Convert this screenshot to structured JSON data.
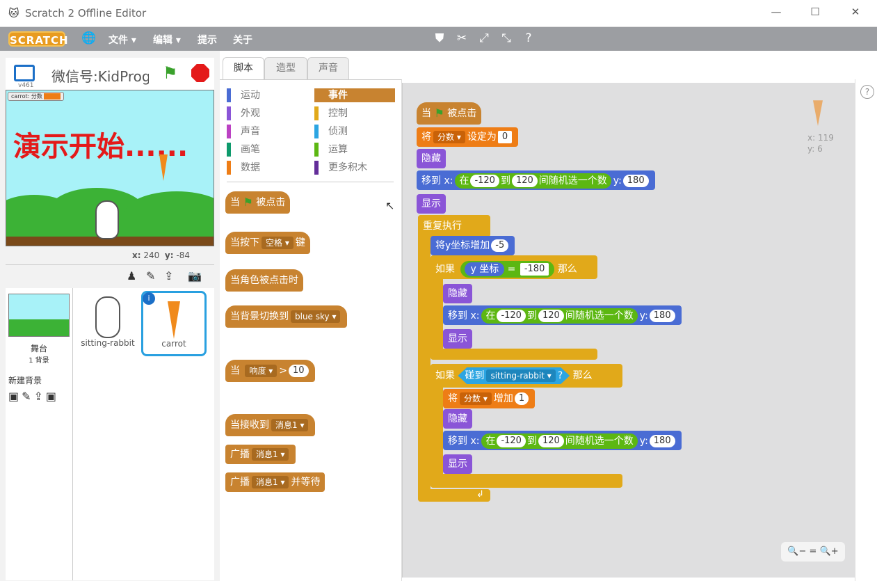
{
  "window": {
    "title": "Scratch 2 Offline Editor",
    "minimize": "—",
    "maximize": "☐",
    "close": "✕"
  },
  "menu": {
    "logo": "SCRATCH",
    "file": "文件 ▾",
    "edit": "编辑 ▾",
    "tips": "提示",
    "about": "关于"
  },
  "stage": {
    "name": "微信号:KidProg",
    "version": "v461",
    "banner": "演示开始......",
    "var_label": "carrot: 分数",
    "x_label": "x:",
    "x_value": "240",
    "y_label": "y:",
    "y_value": "-84"
  },
  "sprites": {
    "stage_label": "舞台",
    "stage_count": "1 背景",
    "new_backdrop": "新建背景",
    "items": [
      "sitting-rabbit",
      "carrot"
    ]
  },
  "tabs": [
    "脚本",
    "造型",
    "声音"
  ],
  "categories_left": [
    "运动",
    "外观",
    "声音",
    "画笔",
    "数据"
  ],
  "categories_right": [
    "事件",
    "控制",
    "侦测",
    "运算",
    "更多积木"
  ],
  "category_colors": [
    "#4a6cd4",
    "#8a55d7",
    "#bb42c3",
    "#0e9a6c",
    "#ee7d16",
    "#c88330",
    "#e1a91a",
    "#2ca5e2",
    "#5cb712",
    "#632d99"
  ],
  "palette": {
    "when_flag": [
      "当",
      "被点击"
    ],
    "when_key": [
      "当按下",
      "空格 ▾",
      "键"
    ],
    "when_sprite_clicked": "当角色被点击时",
    "when_backdrop": [
      "当背景切换到",
      "blue sky ▾"
    ],
    "when_loudness": [
      "当",
      "响度 ▾",
      ">",
      "10"
    ],
    "when_receive": [
      "当接收到",
      "消息1 ▾"
    ],
    "broadcast": [
      "广播",
      "消息1 ▾"
    ],
    "broadcast_wait": [
      "广播",
      "消息1 ▾",
      "并等待"
    ]
  },
  "script": {
    "hat": [
      "当",
      "被点击"
    ],
    "set_var": [
      "将",
      "分数 ▾",
      "设定为",
      "0"
    ],
    "hide": "隐藏",
    "show": "显示",
    "goto": [
      "移到 x:",
      "在",
      "-120",
      "到",
      "120",
      "间随机选一个数",
      "y:",
      "180"
    ],
    "forever": "重复执行",
    "change_y": [
      "将y坐标增加",
      "-5"
    ],
    "if1": [
      "如果",
      "y 坐标",
      "=",
      "-180",
      "那么"
    ],
    "if2": [
      "如果",
      "碰到",
      "sitting-rabbit ▾",
      "?",
      "那么"
    ],
    "change_var": [
      "将",
      "分数 ▾",
      "增加",
      "1"
    ],
    "repeat_arrow": "↲"
  },
  "sprite_info": {
    "x": "x: 119",
    "y": "y: 6"
  },
  "zoom": [
    "🔍−",
    "=",
    "🔍+"
  ],
  "help": "?"
}
